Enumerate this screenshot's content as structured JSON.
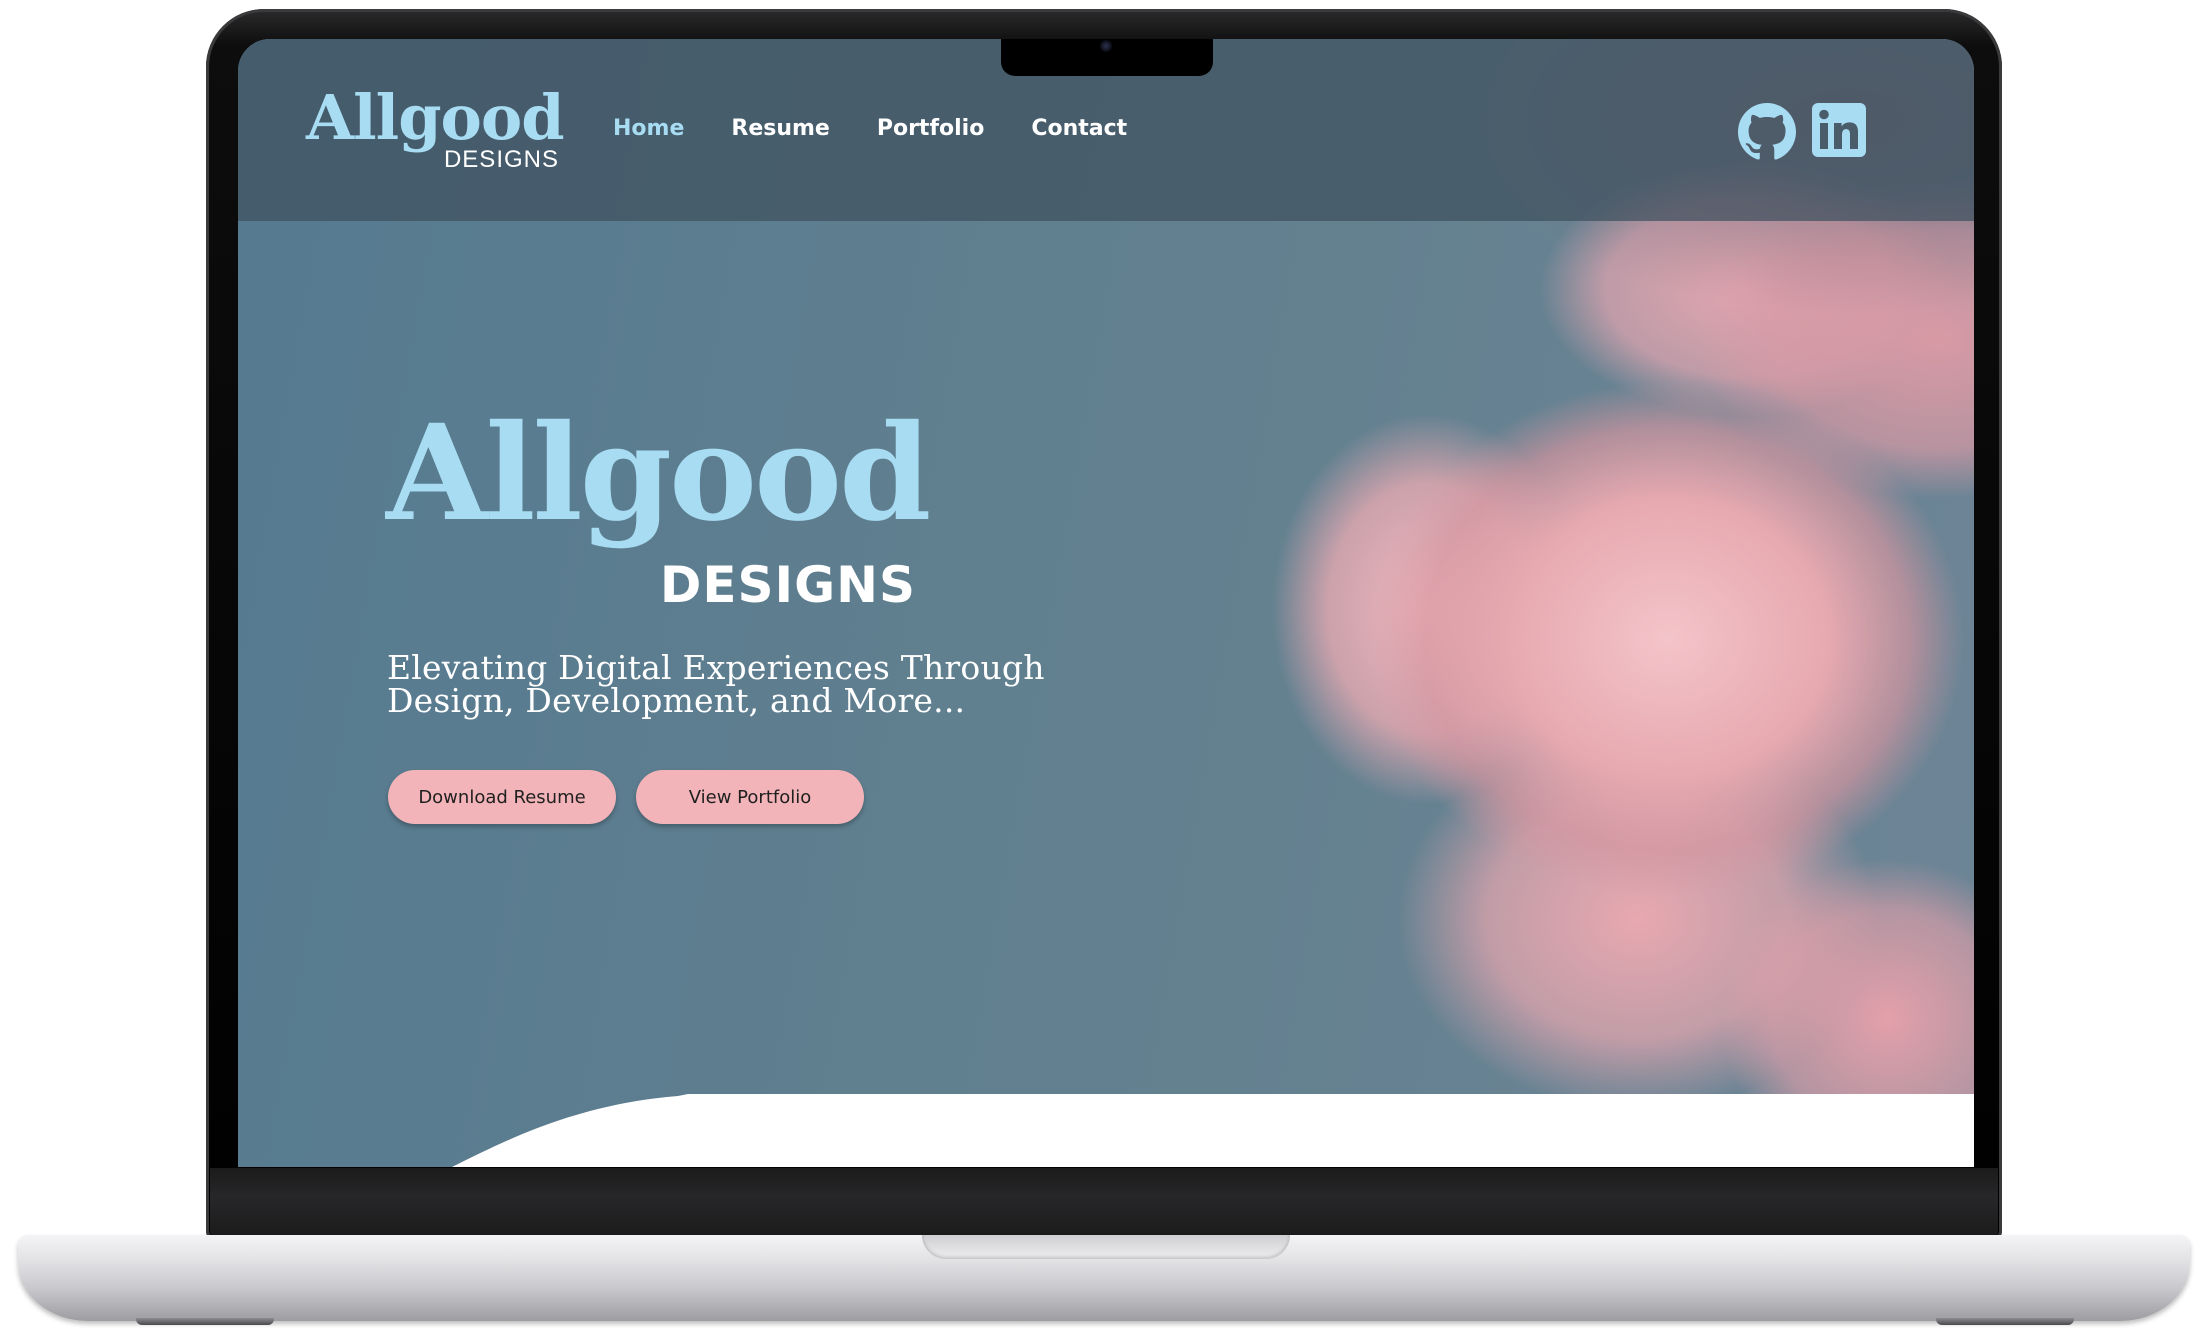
{
  "site": {
    "logo": {
      "script": "Allgood",
      "sub": "DESIGNS"
    },
    "nav": {
      "items": [
        {
          "label": "Home",
          "active": true
        },
        {
          "label": "Resume",
          "active": false
        },
        {
          "label": "Portfolio",
          "active": false
        },
        {
          "label": "Contact",
          "active": false
        }
      ]
    },
    "social": [
      "github-icon",
      "linkedin-icon"
    ],
    "hero": {
      "title_script": "Allgood",
      "title_sub": "DESIGNS",
      "tagline_line1": "Elevating Digital Experiences Through",
      "tagline_line2": "Design, Development, and More...",
      "buttons": {
        "download_resume": "Download Resume",
        "view_portfolio": "View Portfolio"
      }
    }
  },
  "colors": {
    "accent_blue": "#a8dcf2",
    "button_pink": "#f2b4b8",
    "nav_bg": "#3e505e",
    "sky": "#5b7a8f"
  }
}
